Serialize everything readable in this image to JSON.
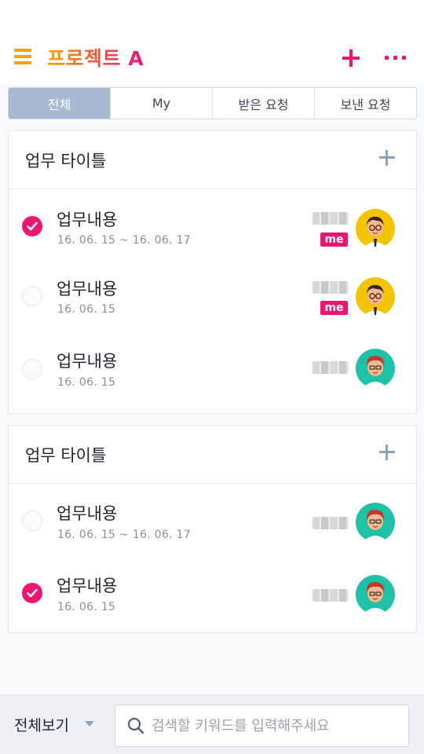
{
  "header": {
    "title": "프로젝트 A",
    "menu_icon": "hamburger-menu-icon",
    "add_icon": "plus-icon",
    "more_icon": "more-horizontal-icon",
    "brand_colors": [
      "#f7a500",
      "#f35a3a",
      "#e8157f"
    ]
  },
  "tabs": [
    {
      "label": "전체",
      "active": true
    },
    {
      "label": "My",
      "active": false
    },
    {
      "label": "받은 요청",
      "active": false
    },
    {
      "label": "보낸 요청",
      "active": false
    }
  ],
  "groups": [
    {
      "title": "업무 타이틀",
      "tasks": [
        {
          "name": "업무내용",
          "date": "16. 06. 15 ~ 16. 06. 17",
          "checked": true,
          "badge": "me",
          "avatar": "man-glasses-avatar"
        },
        {
          "name": "업무내용",
          "date": "16. 06. 15",
          "checked": false,
          "badge": "me",
          "avatar": "man-glasses-avatar"
        },
        {
          "name": "업무내용",
          "date": "16. 06. 15",
          "checked": false,
          "badge": "",
          "avatar": "man-redhair-avatar"
        }
      ]
    },
    {
      "title": "업무 타이틀",
      "tasks": [
        {
          "name": "업무내용",
          "date": "16. 06. 15 ~ 16. 06. 17",
          "checked": false,
          "badge": "",
          "avatar": "man-redhair-avatar"
        },
        {
          "name": "업무내용",
          "date": "16. 06. 15",
          "checked": true,
          "badge": "",
          "avatar": "man-redhair-avatar"
        }
      ]
    }
  ],
  "footer": {
    "view_all_label": "전체보기",
    "search_placeholder": "검색할 키워드를 입력해주세요",
    "search_icon": "search-icon"
  },
  "colors": {
    "accent": "#ee1572",
    "tab_active": "#a6b9d1",
    "muted_icon": "#8fa3bd"
  }
}
